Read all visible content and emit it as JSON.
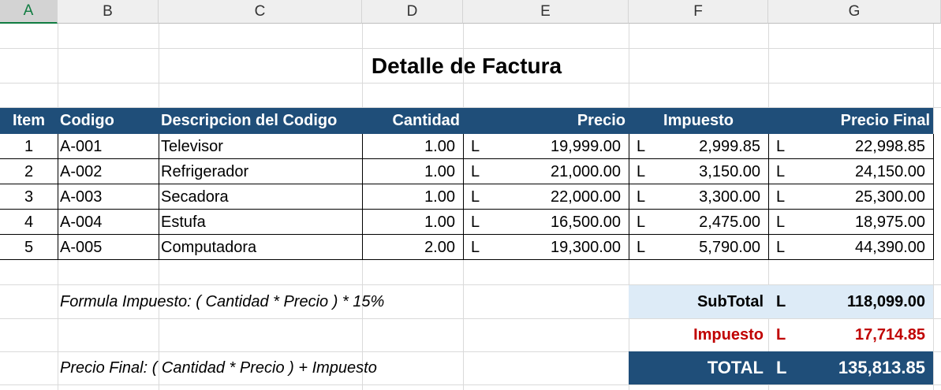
{
  "columns": [
    "A",
    "B",
    "C",
    "D",
    "E",
    "F",
    "G"
  ],
  "title": "Detalle de Factura",
  "headers": {
    "item": "Item",
    "codigo": "Codigo",
    "descripcion": "Descripcion del Codigo",
    "cantidad": "Cantidad",
    "precio": "Precio",
    "impuesto": "Impuesto",
    "precio_final": "Precio Final"
  },
  "currency": "L",
  "rows": [
    {
      "item": "1",
      "codigo": "A-001",
      "descripcion": "Televisor",
      "cantidad": "1.00",
      "precio": "19,999.00",
      "impuesto": "2,999.85",
      "precio_final": "22,998.85"
    },
    {
      "item": "2",
      "codigo": "A-002",
      "descripcion": "Refrigerador",
      "cantidad": "1.00",
      "precio": "21,000.00",
      "impuesto": "3,150.00",
      "precio_final": "24,150.00"
    },
    {
      "item": "3",
      "codigo": "A-003",
      "descripcion": "Secadora",
      "cantidad": "1.00",
      "precio": "22,000.00",
      "impuesto": "3,300.00",
      "precio_final": "25,300.00"
    },
    {
      "item": "4",
      "codigo": "A-004",
      "descripcion": "Estufa",
      "cantidad": "1.00",
      "precio": "16,500.00",
      "impuesto": "2,475.00",
      "precio_final": "18,975.00"
    },
    {
      "item": "5",
      "codigo": "A-005",
      "descripcion": "Computadora",
      "cantidad": "2.00",
      "precio": "19,300.00",
      "impuesto": "5,790.00",
      "precio_final": "44,390.00"
    }
  ],
  "notes": {
    "formula_impuesto": "Formula Impuesto: ( Cantidad * Precio ) * 15%",
    "formula_precio_final": "Precio Final:  ( Cantidad * Precio ) + Impuesto"
  },
  "summary": {
    "subtotal_label": "SubTotal",
    "subtotal_value": "118,099.00",
    "impuesto_label": "Impuesto",
    "impuesto_value": "17,714.85",
    "total_label": "TOTAL",
    "total_value": "135,813.85"
  },
  "colors": {
    "header_fill": "#1f4e79",
    "subtotal_fill": "#ddebf7",
    "impuesto_text": "#c00000",
    "selected_column": "#107c41"
  }
}
